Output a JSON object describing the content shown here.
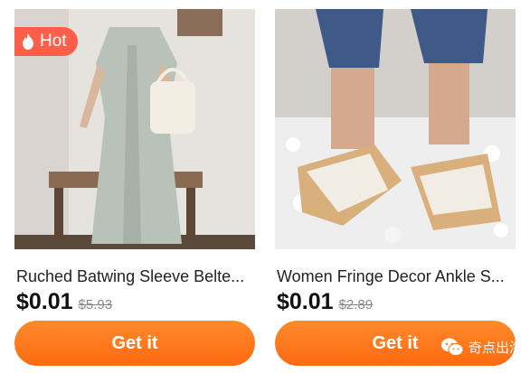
{
  "products": [
    {
      "badge": "Hot",
      "title": "Ruched Batwing Sleeve Belte...",
      "price": "$0.01",
      "old_price": "$5.93",
      "button_label": "Get it"
    },
    {
      "title": "Women Fringe Decor Ankle S...",
      "price": "$0.01",
      "old_price": "$2.89",
      "button_label": "Get it"
    }
  ],
  "watermark": {
    "text": "奇点出海",
    "icon": "wechat-icon"
  },
  "colors": {
    "badge_bg": "#ff5f4a",
    "button_start": "#ff8a2b",
    "button_end": "#ff6a10",
    "price": "#111111",
    "old_price": "#888888"
  }
}
